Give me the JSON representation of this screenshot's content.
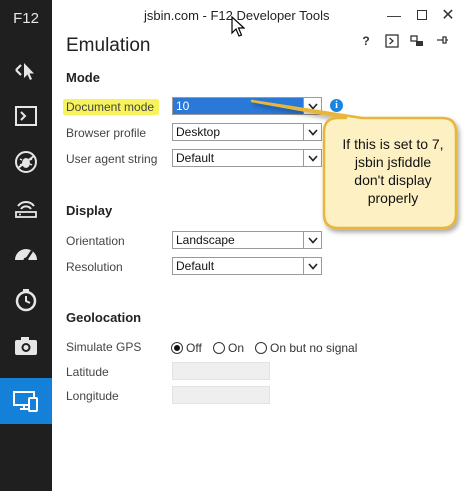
{
  "app": {
    "shortcut": "F12"
  },
  "window": {
    "title": "jsbin.com - F12 Developer Tools"
  },
  "sidebar": {
    "items": [
      {
        "icon": "dom-explorer-icon"
      },
      {
        "icon": "console-icon"
      },
      {
        "icon": "debugger-icon"
      },
      {
        "icon": "network-icon"
      },
      {
        "icon": "performance-icon"
      },
      {
        "icon": "memory-icon"
      },
      {
        "icon": "camera-icon"
      },
      {
        "icon": "emulation-icon",
        "active": true
      }
    ]
  },
  "panel": {
    "title": "Emulation",
    "toolbar": {
      "help": "?"
    }
  },
  "mode": {
    "heading": "Mode",
    "document_mode": {
      "label": "Document mode",
      "value": "10"
    },
    "browser_profile": {
      "label": "Browser profile",
      "value": "Desktop"
    },
    "user_agent": {
      "label": "User agent string",
      "value": "Default"
    }
  },
  "display": {
    "heading": "Display",
    "orientation": {
      "label": "Orientation",
      "value": "Landscape"
    },
    "resolution": {
      "label": "Resolution",
      "value": "Default"
    }
  },
  "geolocation": {
    "heading": "Geolocation",
    "simulate_gps": {
      "label": "Simulate GPS",
      "options": [
        "Off",
        "On",
        "On but no signal"
      ],
      "selected": "Off"
    },
    "latitude": {
      "label": "Latitude",
      "value": ""
    },
    "longitude": {
      "label": "Longitude",
      "value": ""
    }
  },
  "callout": {
    "lines": [
      "If this is set to 7,",
      "jsbin jsfiddle",
      "don't display",
      "properly"
    ]
  },
  "colors": {
    "accent": "#1580d8",
    "highlight": "#f6f35c",
    "callout_fill": "#fdf1c4",
    "callout_border": "#e8b63a"
  }
}
